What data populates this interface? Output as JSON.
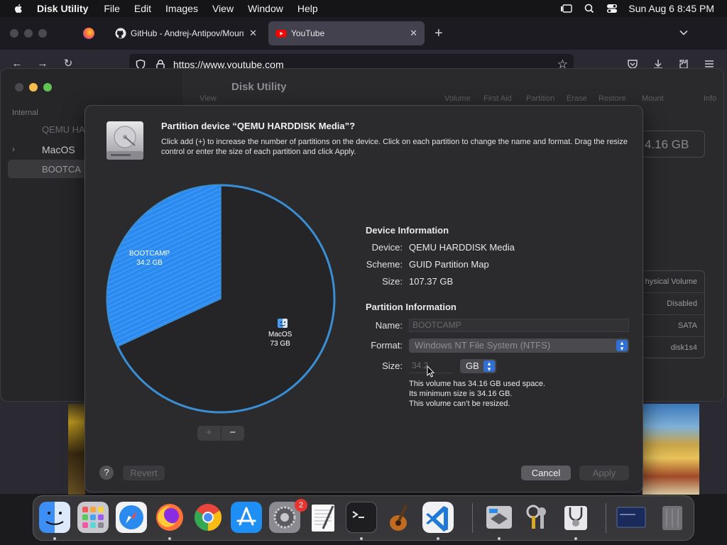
{
  "menubar": {
    "app_name": "Disk Utility",
    "menus": [
      "File",
      "Edit",
      "Images",
      "View",
      "Window",
      "Help"
    ],
    "datetime": "Sun Aug 6  8:45 PM"
  },
  "browser": {
    "tabs": [
      {
        "label": "GitHub - Andrej-Antipov/Mountl",
        "close": "✕"
      },
      {
        "label": "YouTube",
        "close": "✕"
      }
    ],
    "new_tab": "+",
    "url": "https://www.youtube.com"
  },
  "disk_utility": {
    "title": "Disk Utility",
    "view_label": "View",
    "sidebar_section": "Internal",
    "sidebar_items": [
      "QEMU HA",
      "MacOS",
      "BOOTCA"
    ],
    "toolbar": [
      "Volume",
      "First Aid",
      "Partition",
      "Erase",
      "Restore",
      "Mount",
      "Info"
    ],
    "capacity": "4.16 GB",
    "info_rows": [
      "hysical Volume",
      "Disabled",
      "SATA",
      "disk1s4"
    ]
  },
  "sheet": {
    "title": "Partition device “QEMU HARDDISK Media”?",
    "description": "Click add (+) to increase the number of partitions on the device. Click on each partition to change the name and format. Drag the resize control or enter the size of each partition and click Apply.",
    "pie": {
      "bootcamp_name": "BOOTCAMP",
      "bootcamp_size": "34.2 GB",
      "macos_name": "MacOS",
      "macos_size": "73 GB",
      "colors": {
        "bootcamp": "#2a8af0",
        "macos": "#252527",
        "ring": "#3a8fd4"
      }
    },
    "plus": "+",
    "minus": "−",
    "device_info": {
      "heading": "Device Information",
      "device_label": "Device:",
      "device_value": "QEMU HARDDISK Media",
      "scheme_label": "Scheme:",
      "scheme_value": "GUID Partition Map",
      "size_label": "Size:",
      "size_value": "107.37 GB"
    },
    "partition_info": {
      "heading": "Partition Information",
      "name_label": "Name:",
      "name_value": "BOOTCAMP",
      "format_label": "Format:",
      "format_value": "Windows NT File System (NTFS)",
      "size_label": "Size:",
      "size_value": "34.2",
      "unit": "GB",
      "note": [
        "This volume has 34.16 GB used space.",
        "Its minimum size is 34.16 GB.",
        "This volume can’t be resized."
      ]
    },
    "help": "?",
    "revert": "Revert",
    "cancel": "Cancel",
    "apply": "Apply"
  },
  "dock": {
    "apps": [
      "finder-icon",
      "launchpad-icon",
      "safari-icon",
      "firefox-icon",
      "chrome-icon",
      "app-store-icon",
      "system-settings-icon",
      "textedit-icon",
      "terminal-icon",
      "garageband-icon",
      "vscode-icon",
      "boot-camp-assistant-icon",
      "keychain-access-icon",
      "disk-utility-icon",
      "screen-window-icon",
      "trash-icon"
    ],
    "settings_badge": "2"
  }
}
